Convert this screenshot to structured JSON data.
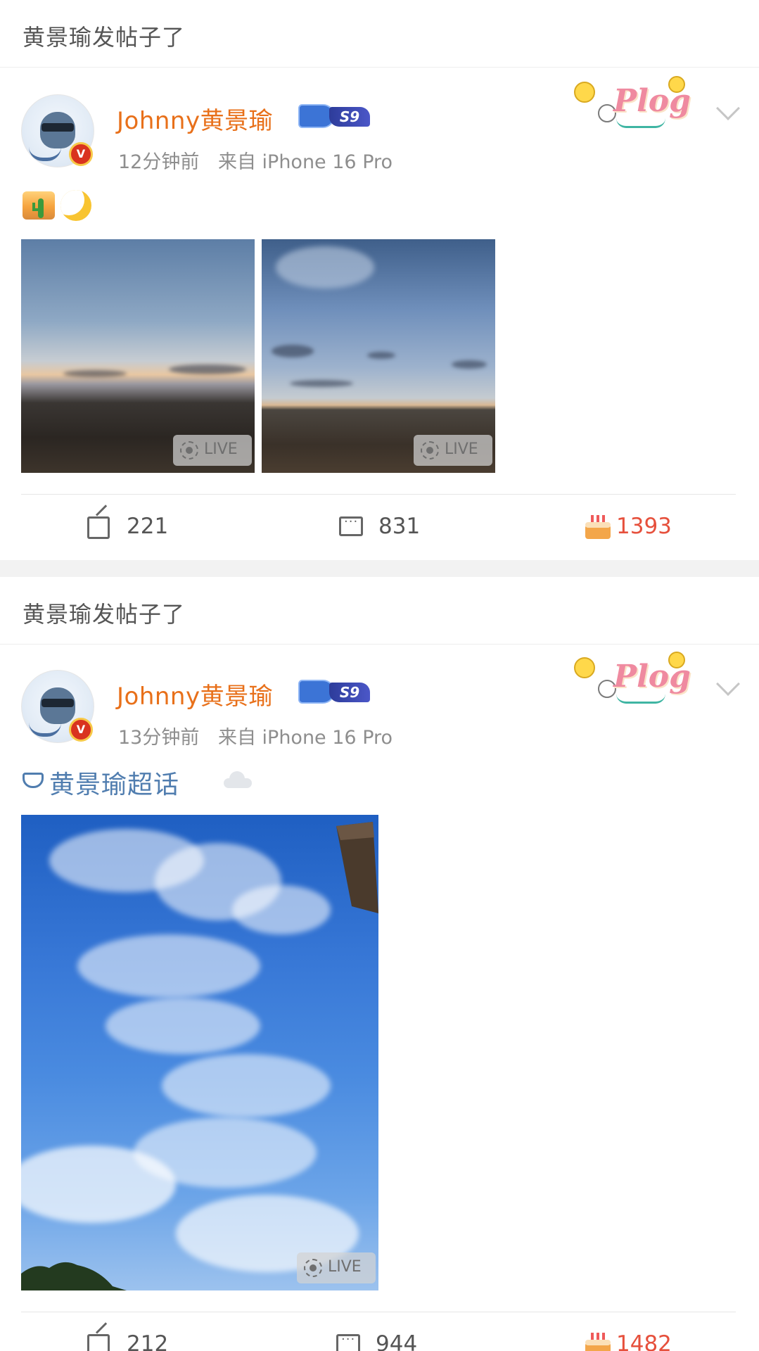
{
  "colors": {
    "username": "#e8701a",
    "topic": "#507daf",
    "likes": "#e6503c",
    "meta": "#8e8e8e"
  },
  "posts": [
    {
      "section_header": "黄景瑜发帖子了",
      "author": "Johnny黄景瑜",
      "level_badge": "S9",
      "verified_badge": "V",
      "time": "12分钟前",
      "source": "来自 iPhone 16 Pro",
      "decoration_text": "Plog",
      "text_emojis": [
        "desert-emoji",
        "crescent-moon-emoji"
      ],
      "images": [
        {
          "kind": "desert-dusk",
          "live_label": "LIVE"
        },
        {
          "kind": "desert-sky",
          "live_label": "LIVE"
        }
      ],
      "actions": {
        "reposts": "221",
        "comments": "831",
        "likes": "1393"
      }
    },
    {
      "section_header": "黄景瑜发帖子了",
      "author": "Johnny黄景瑜",
      "level_badge": "S9",
      "verified_badge": "V",
      "time": "13分钟前",
      "source": "来自 iPhone 16 Pro",
      "decoration_text": "Plog",
      "topic": "黄景瑜超话",
      "text_emojis": [
        "cloud-emoji"
      ],
      "images": [
        {
          "kind": "blue-sky-clouds",
          "live_label": "LIVE"
        }
      ],
      "actions": {
        "reposts": "212",
        "comments": "944",
        "likes": "1482"
      }
    }
  ]
}
